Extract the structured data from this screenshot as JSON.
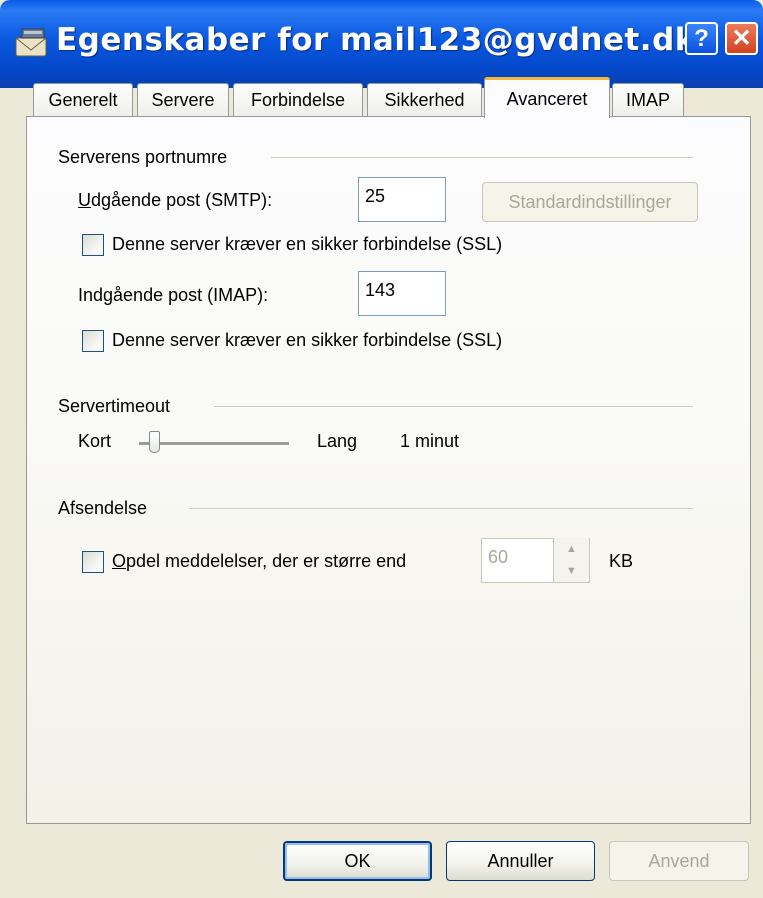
{
  "window": {
    "title": "Egenskaber for mail123@gvdnet.dk",
    "help_glyph": "?",
    "close_glyph": "✕"
  },
  "tabs": [
    {
      "label": "Generelt",
      "active": false
    },
    {
      "label": "Servere",
      "active": false
    },
    {
      "label": "Forbindelse",
      "active": false
    },
    {
      "label": "Sikkerhed",
      "active": false
    },
    {
      "label": "Avanceret",
      "active": true
    },
    {
      "label": "IMAP",
      "active": false
    }
  ],
  "ports": {
    "group_label": "Serverens portnumre",
    "smtp_label": "Udgående post (SMTP):",
    "smtp_value": "25",
    "default_button": "Standardindstillinger",
    "smtp_ssl_label": "Denne server kræver en sikker forbindelse (SSL)",
    "smtp_ssl_checked": false,
    "imap_label": "Indgående post (IMAP):",
    "imap_value": "143",
    "imap_ssl_label": "Denne server kræver en sikker forbindelse (SSL)",
    "imap_ssl_checked": false
  },
  "timeout": {
    "group_label": "Servertimeout",
    "short_label": "Kort",
    "long_label": "Lang",
    "value_label": "1 minut",
    "slider_fraction": 0.1
  },
  "sending": {
    "group_label": "Afsendelse",
    "split_label": "Opdel meddelelser, der er større end",
    "split_checked": false,
    "split_value": "60",
    "unit": "KB"
  },
  "footer": {
    "ok": "OK",
    "cancel": "Annuller",
    "apply": "Anvend"
  },
  "colors": {
    "titlebar": "#0a58e0",
    "tab_highlight": "#f3b33e",
    "dialog_bg": "#ece9d8"
  }
}
